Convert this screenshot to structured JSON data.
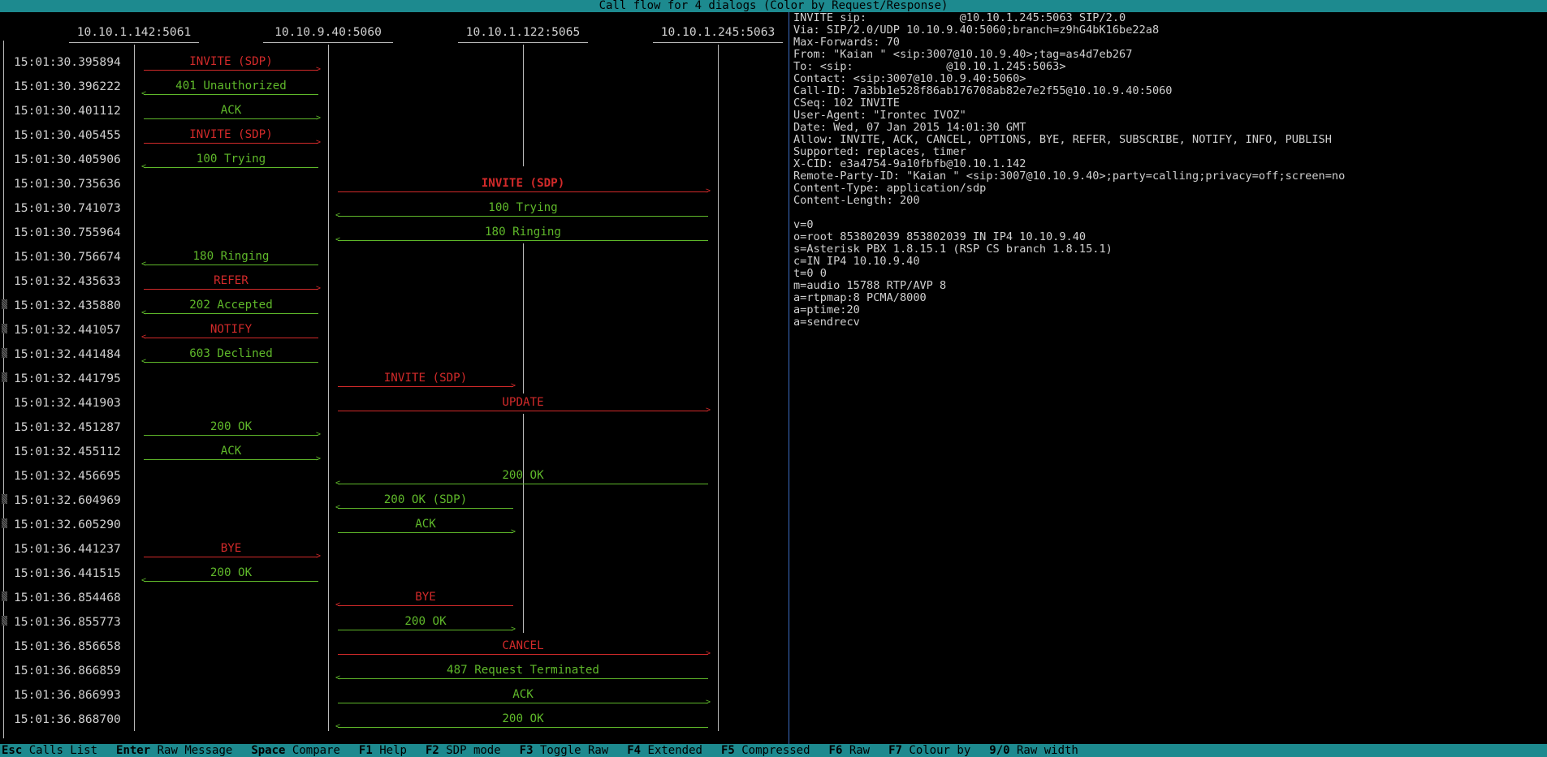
{
  "window": {
    "title": "Call flow for 4 dialogs (Color by Request/Response)"
  },
  "colors": {
    "request": "#d22a2a",
    "response": "#5fb82a",
    "bar": "#1d8a8f",
    "divider": "#3b6bbf"
  },
  "hosts": [
    "10.10.1.142:5061",
    "10.10.9.40:5060",
    "10.10.1.122:5065",
    "10.10.1.245:5063"
  ],
  "messages": [
    {
      "ts": "15:01:30.395894",
      "label": "INVITE (SDP)",
      "from": 0,
      "to": 1,
      "kind": "req"
    },
    {
      "ts": "15:01:30.396222",
      "label": "401 Unauthorized",
      "from": 1,
      "to": 0,
      "kind": "resp"
    },
    {
      "ts": "15:01:30.401112",
      "label": "ACK",
      "from": 0,
      "to": 1,
      "kind": "resp"
    },
    {
      "ts": "15:01:30.405455",
      "label": "INVITE (SDP)",
      "from": 0,
      "to": 1,
      "kind": "req"
    },
    {
      "ts": "15:01:30.405906",
      "label": "100 Trying",
      "from": 1,
      "to": 0,
      "kind": "resp"
    },
    {
      "ts": "15:01:30.735636",
      "label": "INVITE (SDP)",
      "from": 1,
      "to": 3,
      "kind": "req",
      "bold": true
    },
    {
      "ts": "15:01:30.741073",
      "label": "100 Trying",
      "from": 3,
      "to": 1,
      "kind": "resp"
    },
    {
      "ts": "15:01:30.755964",
      "label": "180 Ringing",
      "from": 3,
      "to": 1,
      "kind": "resp"
    },
    {
      "ts": "15:01:30.756674",
      "label": "180 Ringing",
      "from": 1,
      "to": 0,
      "kind": "resp"
    },
    {
      "ts": "15:01:32.435633",
      "label": "REFER",
      "from": 0,
      "to": 1,
      "kind": "req"
    },
    {
      "ts": "15:01:32.435880",
      "label": "202 Accepted",
      "from": 1,
      "to": 0,
      "kind": "resp",
      "gutter": true
    },
    {
      "ts": "15:01:32.441057",
      "label": "NOTIFY",
      "from": 1,
      "to": 0,
      "kind": "req",
      "gutter": true
    },
    {
      "ts": "15:01:32.441484",
      "label": "603 Declined",
      "from": 1,
      "to": 0,
      "kind": "resp",
      "gutter": true
    },
    {
      "ts": "15:01:32.441795",
      "label": "INVITE (SDP)",
      "from": 1,
      "to": 2,
      "kind": "req",
      "gutter": true
    },
    {
      "ts": "15:01:32.441903",
      "label": "UPDATE",
      "from": 1,
      "to": 3,
      "kind": "req"
    },
    {
      "ts": "15:01:32.451287",
      "label": "200 OK",
      "from": 0,
      "to": 1,
      "kind": "resp"
    },
    {
      "ts": "15:01:32.455112",
      "label": "ACK",
      "from": 0,
      "to": 1,
      "kind": "resp"
    },
    {
      "ts": "15:01:32.456695",
      "label": "200 OK",
      "from": 3,
      "to": 1,
      "kind": "resp"
    },
    {
      "ts": "15:01:32.604969",
      "label": "200 OK (SDP)",
      "from": 2,
      "to": 1,
      "kind": "resp",
      "gutter": true
    },
    {
      "ts": "15:01:32.605290",
      "label": "ACK",
      "from": 1,
      "to": 2,
      "kind": "resp",
      "gutter": true
    },
    {
      "ts": "15:01:36.441237",
      "label": "BYE",
      "from": 0,
      "to": 1,
      "kind": "req"
    },
    {
      "ts": "15:01:36.441515",
      "label": "200 OK",
      "from": 1,
      "to": 0,
      "kind": "resp"
    },
    {
      "ts": "15:01:36.854468",
      "label": "BYE",
      "from": 2,
      "to": 1,
      "kind": "req",
      "gutter": true
    },
    {
      "ts": "15:01:36.855773",
      "label": "200 OK",
      "from": 1,
      "to": 2,
      "kind": "resp",
      "gutter": true
    },
    {
      "ts": "15:01:36.856658",
      "label": "CANCEL",
      "from": 1,
      "to": 3,
      "kind": "req"
    },
    {
      "ts": "15:01:36.866859",
      "label": "487 Request Terminated",
      "from": 3,
      "to": 1,
      "kind": "resp"
    },
    {
      "ts": "15:01:36.866993",
      "label": "ACK",
      "from": 1,
      "to": 3,
      "kind": "resp"
    },
    {
      "ts": "15:01:36.868700",
      "label": "200 OK",
      "from": 3,
      "to": 1,
      "kind": "resp"
    }
  ],
  "raw_message": [
    "INVITE sip:              @10.10.1.245:5063 SIP/2.0",
    "Via: SIP/2.0/UDP 10.10.9.40:5060;branch=z9hG4bK16be22a8",
    "Max-Forwards: 70",
    "From: \"Kaian \" <sip:3007@10.10.9.40>;tag=as4d7eb267",
    "To: <sip:              @10.10.1.245:5063>",
    "Contact: <sip:3007@10.10.9.40:5060>",
    "Call-ID: 7a3bb1e528f86ab176708ab82e7e2f55@10.10.9.40:5060",
    "CSeq: 102 INVITE",
    "User-Agent: \"Irontec IVOZ\"",
    "Date: Wed, 07 Jan 2015 14:01:30 GMT",
    "Allow: INVITE, ACK, CANCEL, OPTIONS, BYE, REFER, SUBSCRIBE, NOTIFY, INFO, PUBLISH",
    "Supported: replaces, timer",
    "X-CID: e3a4754-9a10fbfb@10.10.1.142",
    "Remote-Party-ID: \"Kaian \" <sip:3007@10.10.9.40>;party=calling;privacy=off;screen=no",
    "Content-Type: application/sdp",
    "Content-Length: 200",
    "",
    "v=0",
    "o=root 853802039 853802039 IN IP4 10.10.9.40",
    "s=Asterisk PBX 1.8.15.1 (RSP CS branch 1.8.15.1)",
    "c=IN IP4 10.10.9.40",
    "t=0 0",
    "m=audio 15788 RTP/AVP 8",
    "a=rtpmap:8 PCMA/8000",
    "a=ptime:20",
    "a=sendrecv"
  ],
  "footer": [
    {
      "key": "Esc",
      "label": "Calls List"
    },
    {
      "key": "Enter",
      "label": "Raw Message"
    },
    {
      "key": "Space",
      "label": "Compare"
    },
    {
      "key": "F1",
      "label": "Help"
    },
    {
      "key": "F2",
      "label": "SDP mode"
    },
    {
      "key": "F3",
      "label": "Toggle Raw"
    },
    {
      "key": "F4",
      "label": "Extended"
    },
    {
      "key": "F5",
      "label": "Compressed"
    },
    {
      "key": "F6",
      "label": "Raw"
    },
    {
      "key": "F7",
      "label": "Colour by"
    },
    {
      "key": "9/0",
      "label": "Raw width"
    }
  ]
}
